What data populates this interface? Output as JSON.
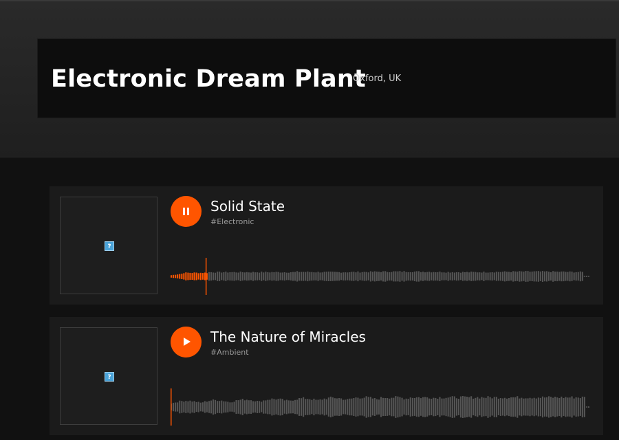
{
  "artist": {
    "name": "Electronic Dream Plant",
    "location": "Oxford, UK"
  },
  "tracks": [
    {
      "title": "Solid State",
      "tag": "#Electronic",
      "state": "playing",
      "button_icon": "pause-icon",
      "progress": 0.085,
      "cover_icon": "broken-image-icon"
    },
    {
      "title": "The Nature of Miracles",
      "tag": "#Ambient",
      "state": "paused",
      "button_icon": "play-icon",
      "progress": 0.0,
      "cover_icon": "broken-image-icon"
    }
  ],
  "colors": {
    "accent": "#ff5500",
    "background": "#111111",
    "card": "#1b1b1b",
    "waveform": "#555555"
  }
}
